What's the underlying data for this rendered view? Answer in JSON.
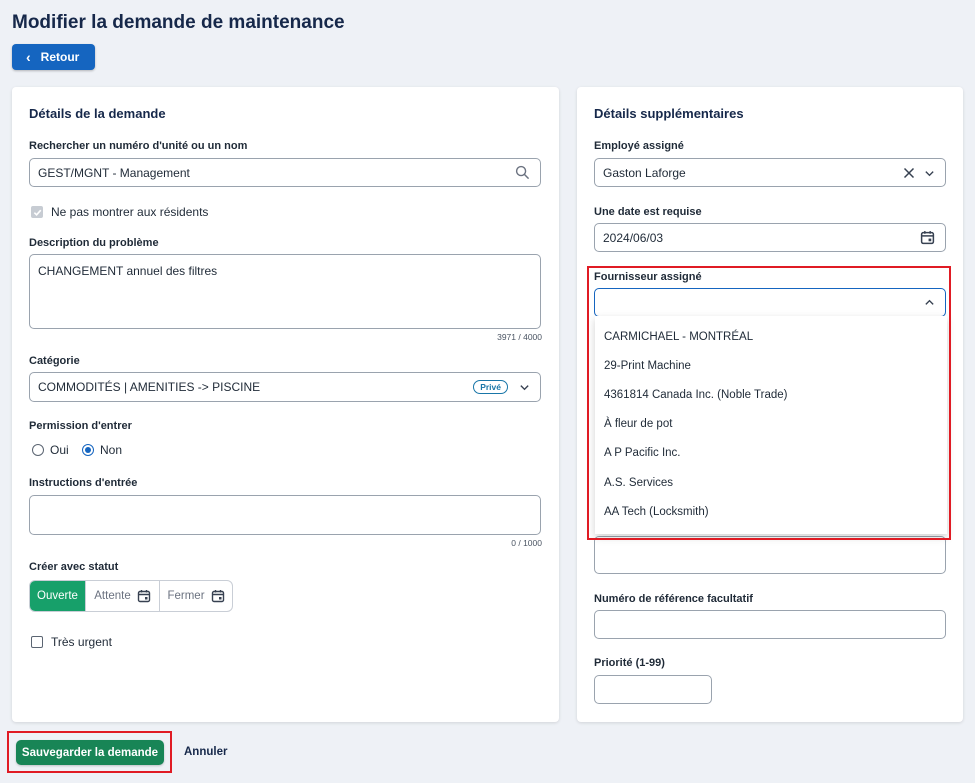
{
  "page": {
    "title": "Modifier la demande de maintenance",
    "back_label": "Retour"
  },
  "left": {
    "title": "Détails de la demande",
    "unit_search": {
      "label": "Rechercher un numéro d'unité ou un nom",
      "value": "GEST/MGNT - Management",
      "icon": "search-icon"
    },
    "hide_residents": {
      "label": "Ne pas montrer aux résidents",
      "checked": true
    },
    "description": {
      "label": "Description du problème",
      "value": "CHANGEMENT annuel des filtres",
      "counter": "3971 / 4000"
    },
    "category": {
      "label": "Catégorie",
      "value": "COMMODITÉS | AMENITIES -> PISCINE",
      "badge": "Privé"
    },
    "entry_permission": {
      "label": "Permission d'entrer",
      "options": [
        "Oui",
        "Non"
      ],
      "selected": "Non"
    },
    "entry_instructions": {
      "label": "Instructions d'entrée",
      "value": "",
      "counter": "0 / 1000"
    },
    "status": {
      "label": "Créer avec statut",
      "options": [
        "Ouverte",
        "Attente",
        "Fermer"
      ],
      "selected": "Ouverte"
    },
    "urgent": {
      "label": "Très urgent",
      "checked": false
    }
  },
  "right": {
    "title": "Détails supplémentaires",
    "assigned_employee": {
      "label": "Employé assigné",
      "value": "Gaston Laforge"
    },
    "required_date": {
      "label": "Une date est requise",
      "value": "2024/06/03"
    },
    "assigned_supplier": {
      "label": "Fournisseur assigné",
      "value": "",
      "options": [
        "CARMICHAEL - MONTRÉAL",
        "29-Print Machine",
        "4361814 Canada Inc. (Noble Trade)",
        "À fleur de pot",
        "A P Pacific Inc.",
        "A.S. Services",
        "AA Tech (Locksmith)"
      ]
    },
    "reference_number": {
      "label": "Numéro de référence facultatif",
      "value": ""
    },
    "priority": {
      "label": "Priorité (1-99)",
      "value": ""
    }
  },
  "footer": {
    "save_label": "Sauvegarder la demande",
    "cancel_label": "Annuler"
  },
  "colors": {
    "primary": "#1565c0",
    "success": "#17a06a",
    "highlight": "#e01b24"
  }
}
